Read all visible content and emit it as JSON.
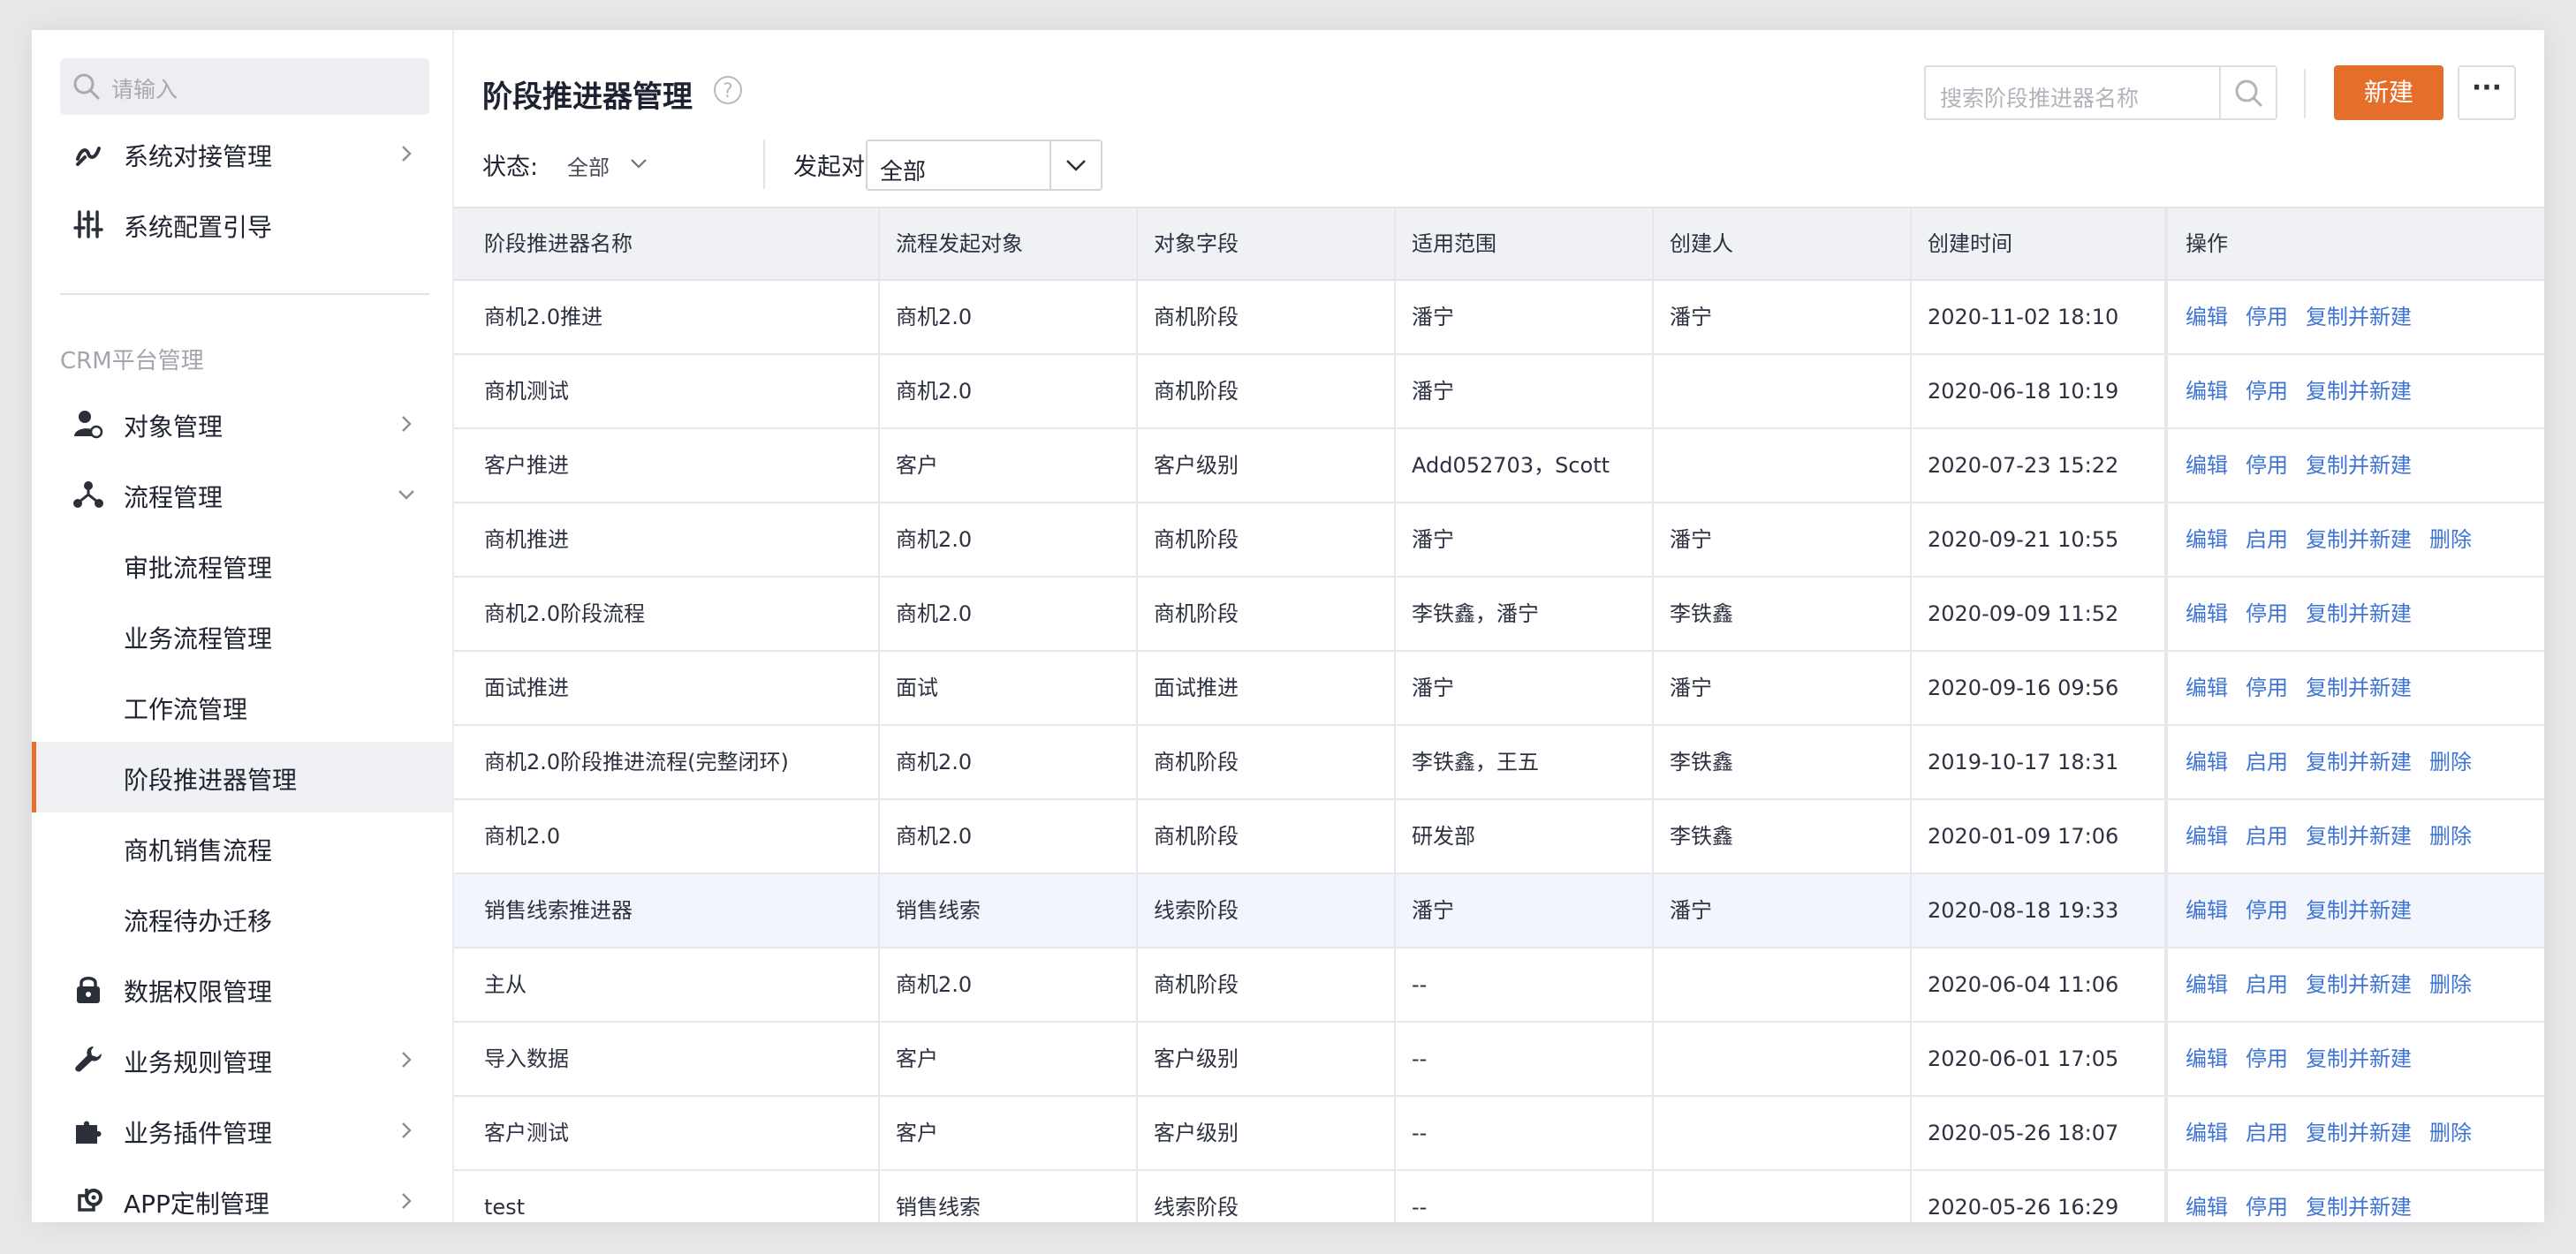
{
  "sidebar": {
    "search_placeholder": "请输入",
    "items_top": [
      {
        "label": "系统对接管理",
        "icon": "link-icon",
        "has_arrow": true
      },
      {
        "label": "系统配置引导",
        "icon": "sliders-icon",
        "has_arrow": false
      }
    ],
    "section_label": "CRM平台管理",
    "items": [
      {
        "label": "对象管理",
        "icon": "user-object-icon",
        "has_arrow": true
      },
      {
        "label": "流程管理",
        "icon": "flow-icon",
        "expanded": true
      },
      {
        "label": "审批流程管理"
      },
      {
        "label": "业务流程管理"
      },
      {
        "label": "工作流管理"
      },
      {
        "label": "阶段推进器管理",
        "active": true
      },
      {
        "label": "商机销售流程"
      },
      {
        "label": "流程待办迁移"
      },
      {
        "label": "数据权限管理",
        "icon": "lock-icon"
      },
      {
        "label": "业务规则管理",
        "icon": "wrench-icon",
        "has_arrow": true
      },
      {
        "label": "业务插件管理",
        "icon": "puzzle-icon",
        "has_arrow": true
      },
      {
        "label": "APP定制管理",
        "icon": "app-gear-icon",
        "has_arrow": true
      }
    ]
  },
  "header": {
    "title": "阶段推进器管理",
    "search_placeholder": "搜索阶段推进器名称",
    "new_label": "新建",
    "more_label": "···"
  },
  "filters": {
    "status_label": "状态:",
    "status_value": "全部",
    "target_label": "发起对象:",
    "target_value": "全部"
  },
  "table": {
    "columns": [
      "阶段推进器名称",
      "流程发起对象",
      "对象字段",
      "适用范围",
      "创建人",
      "创建时间",
      "操作"
    ],
    "rows": [
      {
        "name": "商机2.0推进",
        "target": "商机2.0",
        "field": "商机阶段",
        "scope": "潘宁",
        "creator": "潘宁",
        "time": "2020-11-02 18:10",
        "ops": [
          "编辑",
          "停用",
          "复制并新建"
        ]
      },
      {
        "name": "商机测试",
        "target": "商机2.0",
        "field": "商机阶段",
        "scope": "潘宁",
        "creator": "",
        "time": "2020-06-18 10:19",
        "ops": [
          "编辑",
          "停用",
          "复制并新建"
        ]
      },
      {
        "name": "客户推进",
        "target": "客户",
        "field": "客户级别",
        "scope": "Add052703，Scott",
        "creator": "",
        "time": "2020-07-23 15:22",
        "ops": [
          "编辑",
          "停用",
          "复制并新建"
        ]
      },
      {
        "name": "商机推进",
        "target": "商机2.0",
        "field": "商机阶段",
        "scope": "潘宁",
        "creator": "潘宁",
        "time": "2020-09-21 10:55",
        "ops": [
          "编辑",
          "启用",
          "复制并新建",
          "删除"
        ]
      },
      {
        "name": "商机2.0阶段流程",
        "target": "商机2.0",
        "field": "商机阶段",
        "scope": "李铁鑫，潘宁",
        "creator": "李铁鑫",
        "time": "2020-09-09 11:52",
        "ops": [
          "编辑",
          "停用",
          "复制并新建"
        ]
      },
      {
        "name": "面试推进",
        "target": "面试",
        "field": "面试推进",
        "scope": "潘宁",
        "creator": "潘宁",
        "time": "2020-09-16 09:56",
        "ops": [
          "编辑",
          "停用",
          "复制并新建"
        ]
      },
      {
        "name": "商机2.0阶段推进流程(完整闭环)",
        "target": "商机2.0",
        "field": "商机阶段",
        "scope": "李铁鑫，王五",
        "creator": "李铁鑫",
        "time": "2019-10-17 18:31",
        "ops": [
          "编辑",
          "启用",
          "复制并新建",
          "删除"
        ]
      },
      {
        "name": "商机2.0",
        "target": "商机2.0",
        "field": "商机阶段",
        "scope": "研发部",
        "creator": "李铁鑫",
        "time": "2020-01-09 17:06",
        "ops": [
          "编辑",
          "启用",
          "复制并新建",
          "删除"
        ]
      },
      {
        "name": "销售线索推进器",
        "target": "销售线索",
        "field": "线索阶段",
        "scope": "潘宁",
        "creator": "潘宁",
        "time": "2020-08-18 19:33",
        "ops": [
          "编辑",
          "停用",
          "复制并新建"
        ],
        "highlighted": true
      },
      {
        "name": "主从",
        "target": "商机2.0",
        "field": "商机阶段",
        "scope": "--",
        "creator": "",
        "time": "2020-06-04 11:06",
        "ops": [
          "编辑",
          "启用",
          "复制并新建",
          "删除"
        ]
      },
      {
        "name": "导入数据",
        "target": "客户",
        "field": "客户级别",
        "scope": "--",
        "creator": "",
        "time": "2020-06-01 17:05",
        "ops": [
          "编辑",
          "停用",
          "复制并新建"
        ]
      },
      {
        "name": "客户测试",
        "target": "客户",
        "field": "客户级别",
        "scope": "--",
        "creator": "",
        "time": "2020-05-26 18:07",
        "ops": [
          "编辑",
          "启用",
          "复制并新建",
          "删除"
        ]
      },
      {
        "name": "test",
        "target": "销售线索",
        "field": "线索阶段",
        "scope": "--",
        "creator": "",
        "time": "2020-05-26 16:29",
        "ops": [
          "编辑",
          "停用",
          "复制并新建"
        ]
      }
    ]
  },
  "colors": {
    "accent": "#e56f2a",
    "link": "#3e74d6"
  }
}
